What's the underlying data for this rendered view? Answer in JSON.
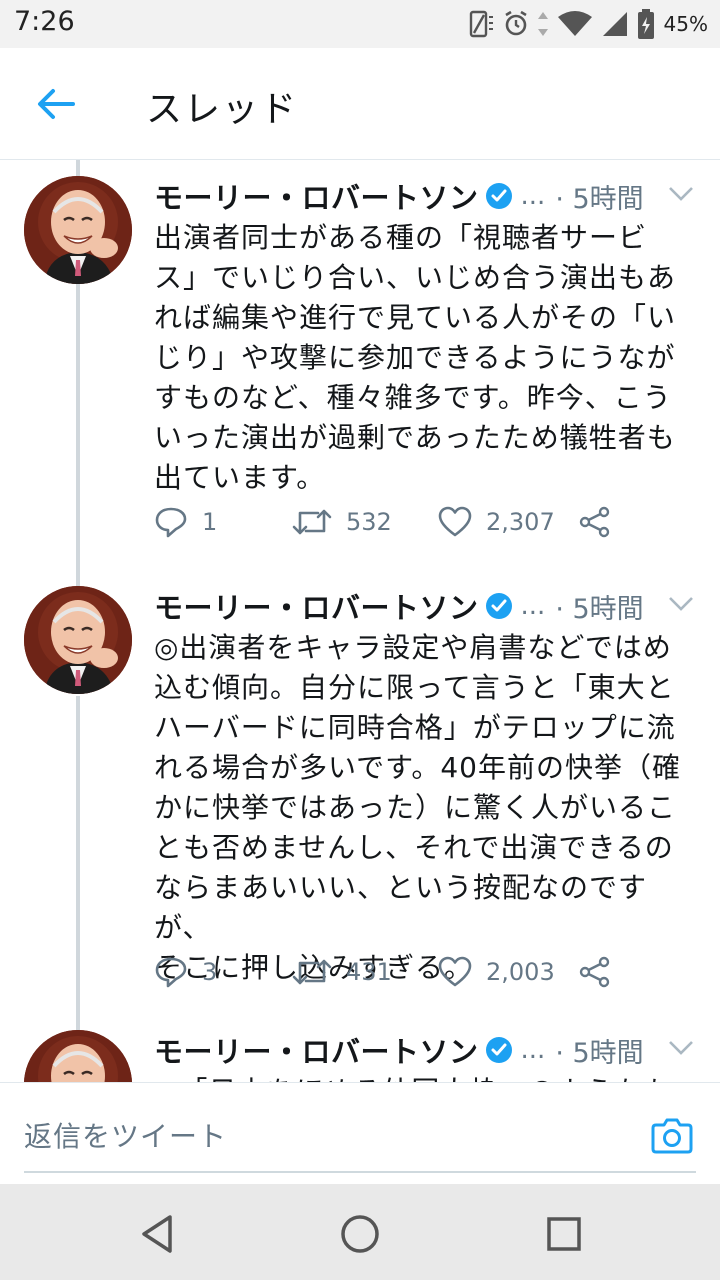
{
  "status_bar": {
    "time": "7:26",
    "battery": "45%"
  },
  "header": {
    "title": "スレッド"
  },
  "tweets": [
    {
      "author": "モーリー・ロバートソン",
      "handle": "...",
      "time": "· 5時間",
      "text": "出演者同士がある種の「視聴者サービ\nス」でいじり合い、いじめ合う演出もあ\nれば編集や進行で見ている人がその「い\nじり」や攻撃に参加できるようにうなが\nすものなど、種々雑多です。昨今、こう\nいった演出が過剰であったため犠牲者も\n出ています。",
      "replies": "1",
      "retweets": "532",
      "likes": "2,307"
    },
    {
      "author": "モーリー・ロバートソン",
      "handle": "...",
      "time": "· 5時間",
      "text": "◎出演者をキャラ設定や肩書などではめ\n込む傾向。自分に限って言うと「東大と\nハーバードに同時合格」がテロップに流\nれる場合が多いです。40年前の快挙（確\nかに快挙ではあった）に驚く人がいるこ\nとも否めませんし、それで出演できるの\nならまあいいい、という按配なのですが、\nそこに押し込みすぎる。",
      "replies": "3",
      "retweets": "431",
      "likes": "2,003"
    },
    {
      "author": "モーリー・ロバートソン",
      "handle": "...",
      "time": "· 5時間",
      "text": "◎「日本をほめる外国人枠」のようなも"
    }
  ],
  "reply_bar": {
    "placeholder": "返信をツイート"
  },
  "colors": {
    "accent": "#1da1f2",
    "secondary_text": "#657786",
    "thread_line": "#d0d7dc"
  }
}
